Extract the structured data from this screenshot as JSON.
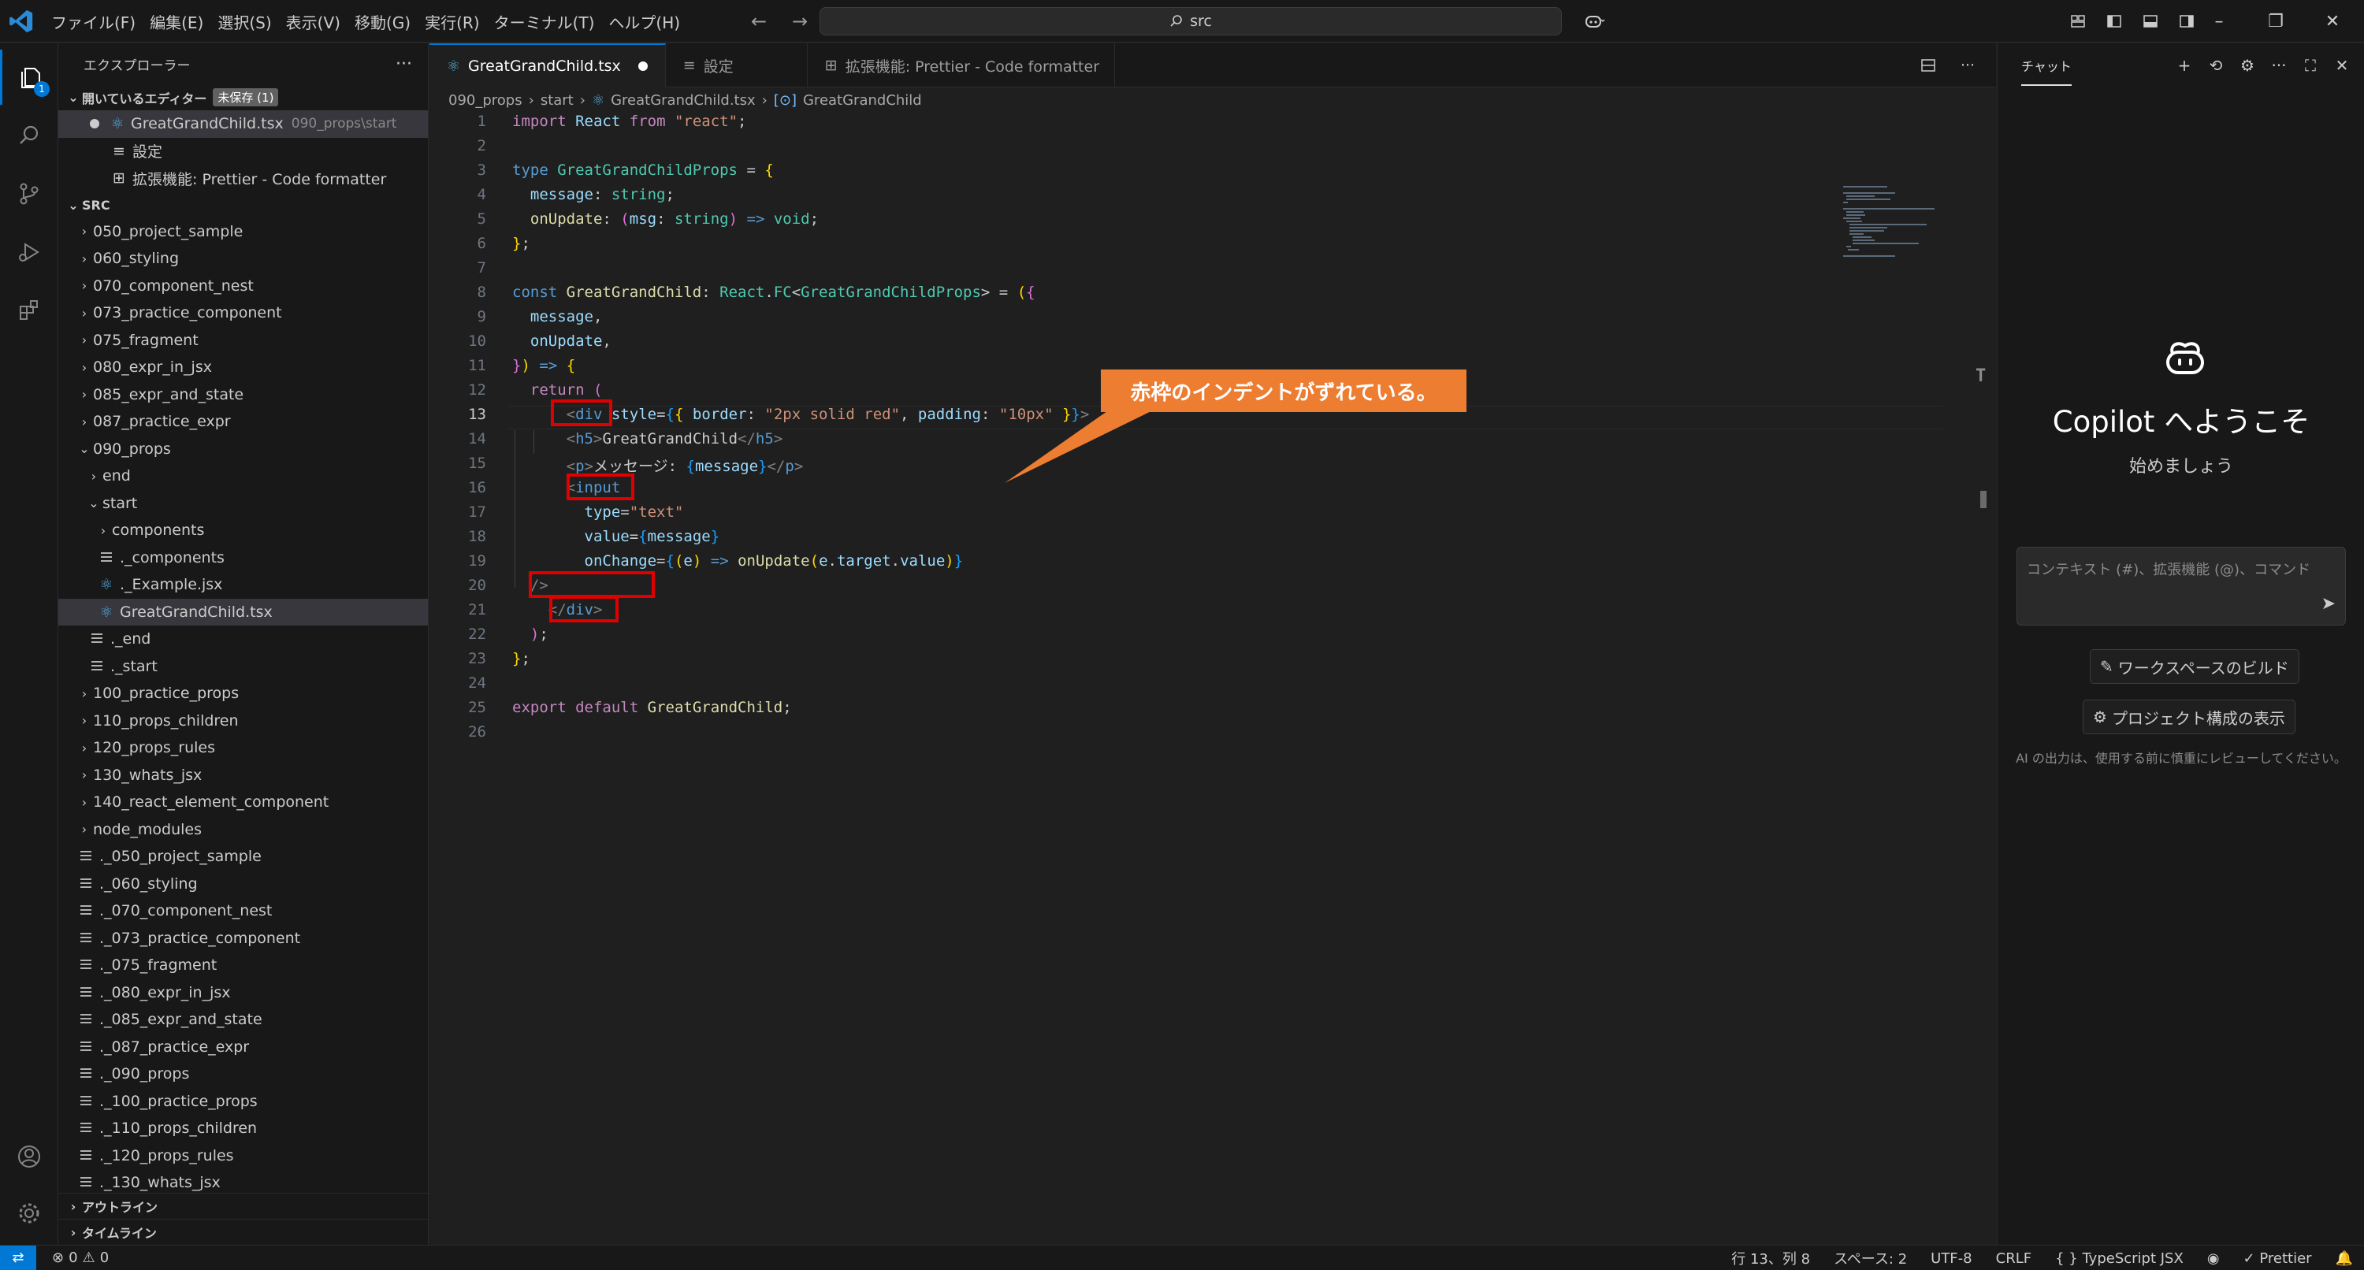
{
  "menubar": [
    "ファイル(F)",
    "編集(E)",
    "選択(S)",
    "表示(V)",
    "移動(G)",
    "実行(R)",
    "ターミナル(T)",
    "ヘルプ(H)"
  ],
  "search": {
    "text": "src"
  },
  "activity": {
    "explorer_badge": "1"
  },
  "sidebar": {
    "title": "エクスプローラー",
    "more": "···",
    "open_editors": {
      "label": "開いているエディター",
      "badge": "未保存 (1)",
      "items": [
        {
          "name": "GreatGrandChild.tsx",
          "path": "090_props\\start"
        },
        {
          "name": "設定"
        },
        {
          "name": "拡張機能: Prettier - Code formatter"
        }
      ]
    },
    "src_label": "SRC",
    "tree": [
      {
        "label": "050_project_sample"
      },
      {
        "label": "060_styling"
      },
      {
        "label": "070_component_nest"
      },
      {
        "label": "073_practice_component"
      },
      {
        "label": "075_fragment"
      },
      {
        "label": "080_expr_in_jsx"
      },
      {
        "label": "085_expr_and_state"
      },
      {
        "label": "087_practice_expr"
      },
      {
        "label": "090_props"
      },
      {
        "label": "end"
      },
      {
        "label": "start"
      },
      {
        "label": "components"
      },
      {
        "label": "._components"
      },
      {
        "label": "._Example.jsx"
      },
      {
        "label": "GreatGrandChild.tsx"
      },
      {
        "label": "._end"
      },
      {
        "label": "._start"
      },
      {
        "label": "100_practice_props"
      },
      {
        "label": "110_props_children"
      },
      {
        "label": "120_props_rules"
      },
      {
        "label": "130_whats_jsx"
      },
      {
        "label": "140_react_element_component"
      },
      {
        "label": "node_modules"
      },
      {
        "label": "._050_project_sample"
      },
      {
        "label": "._060_styling"
      },
      {
        "label": "._070_component_nest"
      },
      {
        "label": "._073_practice_component"
      },
      {
        "label": "._075_fragment"
      },
      {
        "label": "._080_expr_in_jsx"
      },
      {
        "label": "._085_expr_and_state"
      },
      {
        "label": "._087_practice_expr"
      },
      {
        "label": "._090_props"
      },
      {
        "label": "._100_practice_props"
      },
      {
        "label": "._110_props_children"
      },
      {
        "label": "._120_props_rules"
      },
      {
        "label": "._130_whats_jsx"
      }
    ],
    "outline_label": "アウトライン",
    "timeline_label": "タイムライン"
  },
  "tabs": [
    {
      "label": "GreatGrandChild.tsx"
    },
    {
      "label": "設定"
    },
    {
      "label": "拡張機能: Prettier - Code formatter"
    }
  ],
  "breadcrumb": [
    "090_props",
    "start",
    "GreatGrandChild.tsx",
    "GreatGrandChild"
  ],
  "callout": "赤枠のインデントがずれている。",
  "chat": {
    "tab": "チャット",
    "title": "Copilot へようこそ",
    "subtitle": "始めましょう",
    "input_placeholder": "コンテキスト (#)、拡張機能 (@)、コマンド",
    "btn_build": "ワークスペースのビルド",
    "btn_structure": "プロジェクト構成の表示",
    "disclaimer": "AI の出力は、使用する前に慎重にレビューしてください。"
  },
  "status": {
    "errors": "0",
    "warnings": "0",
    "position": "行 13、列 8",
    "spaces": "スペース: 2",
    "encoding": "UTF-8",
    "eol": "CRLF",
    "language": "TypeScript JSX",
    "prettier": "Prettier"
  },
  "colors": {
    "accent": "#0078d4",
    "callout": "#ed7d31",
    "highlight_box": "#e00000"
  }
}
